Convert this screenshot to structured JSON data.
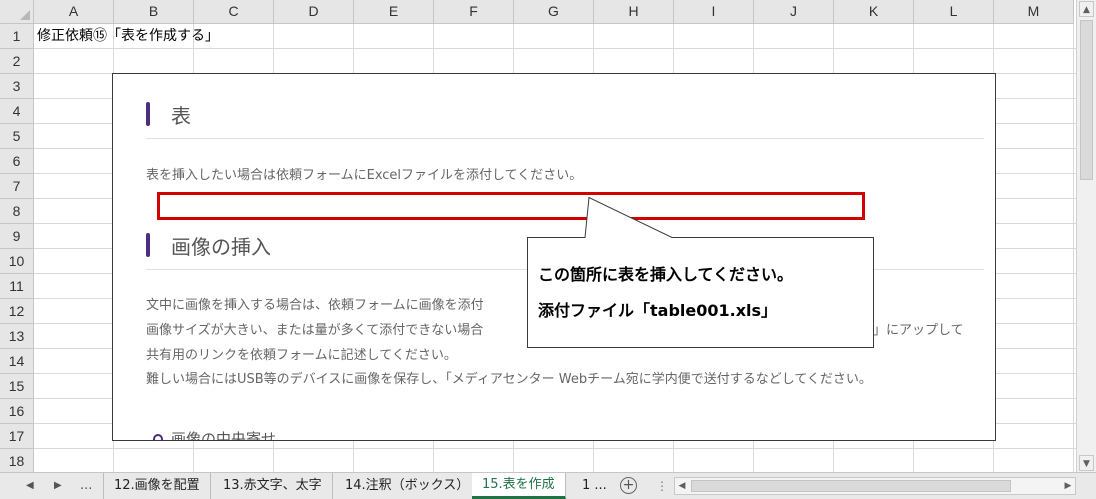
{
  "sheet": {
    "columns": [
      "A",
      "B",
      "C",
      "D",
      "E",
      "F",
      "G",
      "H",
      "I",
      "J",
      "K",
      "L",
      "M"
    ],
    "rows": [
      "1",
      "2",
      "3",
      "4",
      "5",
      "6",
      "7",
      "8",
      "9",
      "10",
      "11",
      "12",
      "13",
      "14",
      "15",
      "16",
      "17",
      "18"
    ],
    "cell_a1": "修正依頼⑮「表を作成する」"
  },
  "embedded": {
    "heading1": "表",
    "text1": "表を挿入したい場合は依頼フォームにExcelファイルを添付してください。",
    "heading2": "画像の挿入",
    "para": [
      "文中に画像を挿入する場合は、依頼フォームに画像を添付",
      "画像サイズが大きい、または量が多くて添付できない場合",
      "共有用のリンクを依頼フォームに記述してください。",
      "難しい場合にはUSB等のデバイスに画像を保存し、「メディアセンター Webチーム宛に学内便で送付するなどしてください。"
    ],
    "para_tail": "」にアップして",
    "subheading": "画像の中央寄せ"
  },
  "callout": {
    "line1": "この箇所に表を挿入してください。",
    "line2": "添付ファイル「table001.xls」"
  },
  "tabbar": {
    "prev": "◀",
    "next": "▶",
    "more_left": "...",
    "tabs": [
      "12.画像を配置",
      "13.赤文字、太字",
      "14.注釈（ボックス）",
      "15.表を作成",
      "1 ..."
    ],
    "active_index": 3,
    "add": "+"
  },
  "colors": {
    "accent": "#4e2d7f",
    "highlight_box": "#d40000",
    "active_tab": "#217346"
  }
}
